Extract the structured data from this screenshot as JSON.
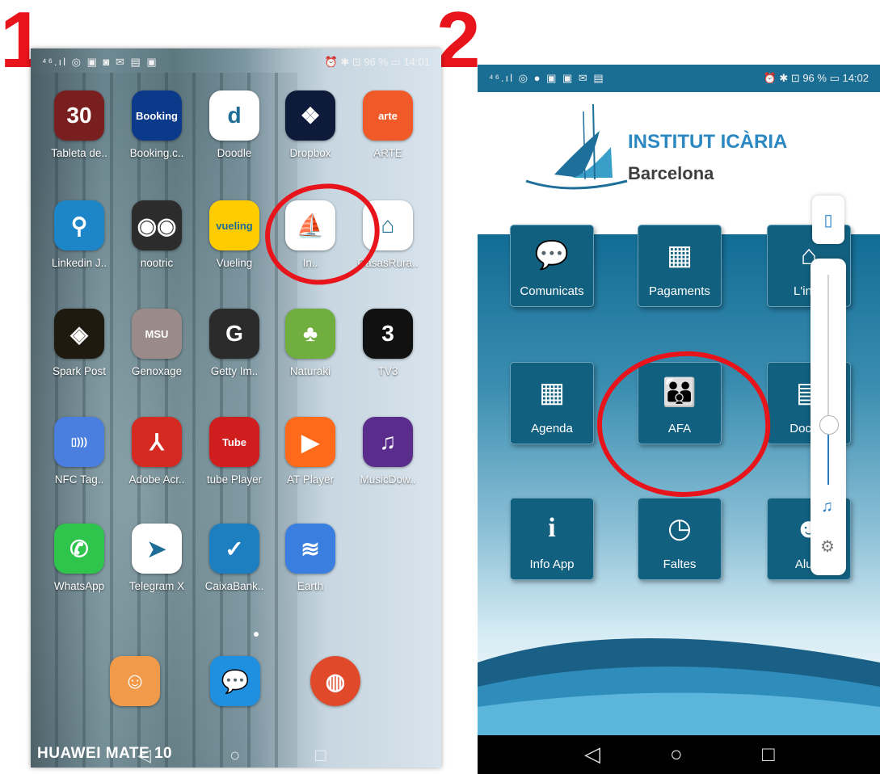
{
  "steps": {
    "first": "1",
    "second": "2"
  },
  "phone1": {
    "status_left": "⁴⁶.ıl ◎ ▣ ◙ ✉ ▤ ▣",
    "status_right": "⏰ ✱ ⊡ 96 % ▭ 14:01",
    "apps": [
      {
        "label": "Tableta de..",
        "icon": "fitness-app-icon",
        "color": "#7a1f1f",
        "glyph": "30"
      },
      {
        "label": "Booking.c..",
        "icon": "booking-icon",
        "color": "#0b3a8a",
        "glyph": "Booking"
      },
      {
        "label": "Doodle",
        "icon": "doodle-icon",
        "color": "#ffffff",
        "glyph": "d"
      },
      {
        "label": "Dropbox",
        "icon": "dropbox-icon",
        "color": "#0d1a3a",
        "glyph": "❖"
      },
      {
        "label": "ARTE",
        "icon": "arte-icon",
        "color": "#f05a28",
        "glyph": "arte"
      },
      {
        "label": "Linkedin J..",
        "icon": "linkedin-jobs-icon",
        "color": "#1c86c8",
        "glyph": "⚲"
      },
      {
        "label": "nootric",
        "icon": "nootric-icon",
        "color": "#2c2c2c",
        "glyph": "◉◉"
      },
      {
        "label": "Vueling",
        "icon": "vueling-icon",
        "color": "#ffcc00",
        "glyph": "vueling"
      },
      {
        "label": "In..",
        "icon": "institut-icaria-app-icon",
        "color": "#ffffff",
        "glyph": "⛵"
      },
      {
        "label": "CasasRura..",
        "icon": "casas-rurales-icon",
        "color": "#ffffff",
        "glyph": "⌂"
      },
      {
        "label": "Spark Post",
        "icon": "spark-post-icon",
        "color": "#1f1a10",
        "glyph": "◈"
      },
      {
        "label": "Genoxage",
        "icon": "genoxage-icon",
        "color": "#9a8a8a",
        "glyph": "MSU"
      },
      {
        "label": "Getty Im..",
        "icon": "getty-images-icon",
        "color": "#2b2b2b",
        "glyph": "G"
      },
      {
        "label": "Naturaki",
        "icon": "naturaki-icon",
        "color": "#6fae3f",
        "glyph": "♣"
      },
      {
        "label": "TV3",
        "icon": "tv3-icon",
        "color": "#111111",
        "glyph": "3"
      },
      {
        "label": "NFC Tag..",
        "icon": "nfc-tag-icon",
        "color": "#4a7fe0",
        "glyph": "▯)))"
      },
      {
        "label": "Adobe Acr..",
        "icon": "adobe-acrobat-icon",
        "color": "#d42a22",
        "glyph": "⅄"
      },
      {
        "label": "tube Player",
        "icon": "tube-video-mp3-icon",
        "color": "#d01d1d",
        "glyph": "Tube"
      },
      {
        "label": "AT Player",
        "icon": "at-player-icon",
        "color": "#ff6a1a",
        "glyph": "▶"
      },
      {
        "label": "MusicDow..",
        "icon": "music-download-icon",
        "color": "#5a2c8c",
        "glyph": "♫"
      },
      {
        "label": "WhatsApp",
        "icon": "whatsapp-icon",
        "color": "#2fc44c",
        "glyph": "✆"
      },
      {
        "label": "Telegram X",
        "icon": "telegram-x-icon",
        "color": "#ffffff",
        "glyph": "➤"
      },
      {
        "label": "CaixaBank..",
        "icon": "caixabank-icon",
        "color": "#1d7fc0",
        "glyph": "✓"
      },
      {
        "label": "Earth",
        "icon": "google-earth-icon",
        "color": "#3a7fe0",
        "glyph": "≋"
      }
    ],
    "dock": [
      {
        "icon": "contacts-icon",
        "color": "#f09a4a",
        "glyph": "☺"
      },
      {
        "icon": "messages-icon",
        "color": "#1f8fe0",
        "glyph": "💬"
      },
      {
        "icon": "browser-icon",
        "color": "#e04a2a",
        "glyph": "◍"
      }
    ],
    "brand": "HUAWEI MATE 10",
    "nav": {
      "back": "◁",
      "home": "○",
      "recent": "□"
    }
  },
  "phone2": {
    "status_left": "⁴⁶.ıl ◎ ● ▣ ▣ ✉ ▤",
    "status_right": "⏰ ✱ ⊡ 96 % ▭ 14:02",
    "header": {
      "title": "INSTITUT ICÀRIA",
      "subtitle": "Barcelona"
    },
    "tiles": [
      {
        "label": "Comunicats",
        "icon": "chat-bubbles-icon",
        "glyph": "💬"
      },
      {
        "label": "Pagaments",
        "icon": "payment-terminal-icon",
        "glyph": "▦"
      },
      {
        "label": "L'insti",
        "icon": "school-building-icon",
        "glyph": "⌂"
      },
      {
        "label": "Agenda",
        "icon": "calendar-check-icon",
        "glyph": "▦"
      },
      {
        "label": "AFA",
        "icon": "family-icon",
        "glyph": "👪"
      },
      {
        "label": "Docum",
        "icon": "documents-icon",
        "glyph": "▤"
      },
      {
        "label": "Info App",
        "icon": "info-icon",
        "glyph": "i"
      },
      {
        "label": "Faltes",
        "icon": "clock-calendar-icon",
        "glyph": "◷"
      },
      {
        "label": "Alum",
        "icon": "students-icon",
        "glyph": "☻"
      }
    ],
    "volume": {
      "level": 0.29,
      "vibrate_glyph": "▯",
      "music_glyph": "♫",
      "settings_glyph": "⚙"
    },
    "nav": {
      "back": "◁",
      "home": "○",
      "recent": "□"
    }
  },
  "colors": {
    "annotation_red": "#e8141b",
    "app_blue": "#12607f",
    "title_blue": "#2b88c0"
  }
}
